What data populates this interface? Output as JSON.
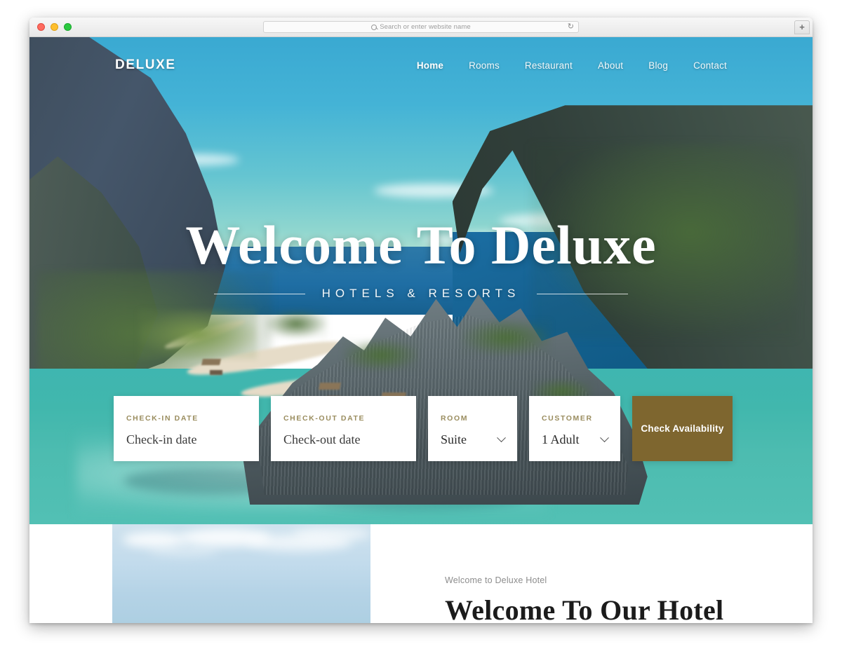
{
  "browser": {
    "search_placeholder": "Search or enter website name",
    "search_icon": "search-icon",
    "reload_icon": "↻",
    "new_tab_label": "+"
  },
  "site": {
    "brand": "DELUXE",
    "nav": [
      {
        "label": "Home",
        "active": true
      },
      {
        "label": "Rooms",
        "active": false
      },
      {
        "label": "Restaurant",
        "active": false
      },
      {
        "label": "About",
        "active": false
      },
      {
        "label": "Blog",
        "active": false
      },
      {
        "label": "Contact",
        "active": false
      }
    ]
  },
  "hero": {
    "title": "Welcome To Deluxe",
    "subtitle": "HOTELS & RESORTS"
  },
  "booking": {
    "fields": [
      {
        "label": "CHECK-IN DATE",
        "value": "Check-in date",
        "type": "date"
      },
      {
        "label": "CHECK-OUT DATE",
        "value": "Check-out date",
        "type": "date"
      },
      {
        "label": "ROOM",
        "value": "Suite",
        "type": "select"
      },
      {
        "label": "CUSTOMER",
        "value": "1 Adult",
        "type": "select"
      }
    ],
    "submit_label": "Check Availability"
  },
  "welcome": {
    "eyebrow": "Welcome to Deluxe Hotel",
    "heading": "Welcome To Our Hotel"
  },
  "colors": {
    "accent_gold": "#7e662f",
    "label_gold": "#9a8d5f",
    "sky_blue": "#3aa9d2",
    "lagoon_teal": "#41b7ad"
  }
}
